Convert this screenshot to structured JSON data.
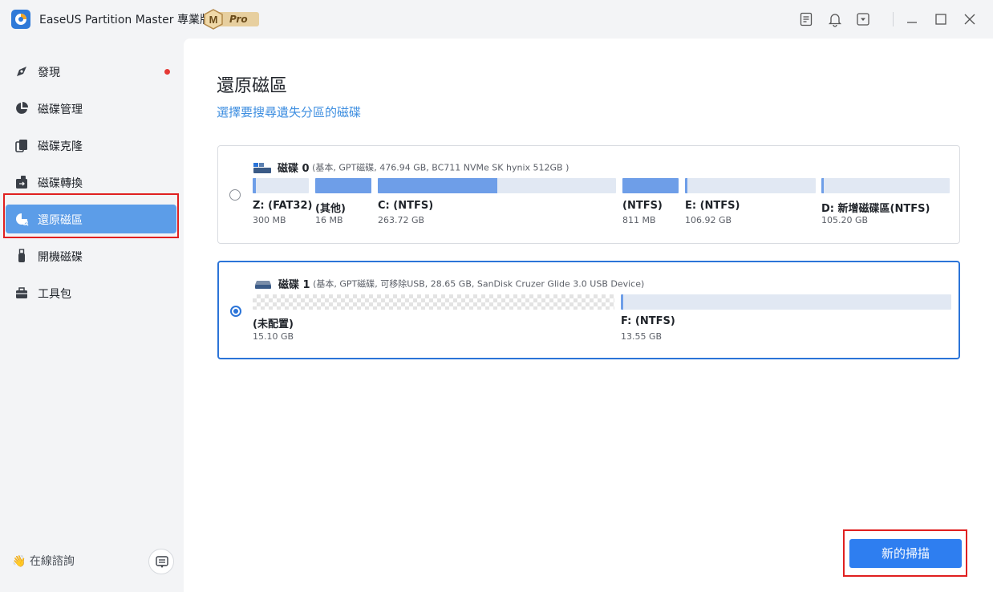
{
  "app": {
    "title": "EaseUS Partition Master 專業版",
    "badge_letter": "M",
    "badge_text": "Pro"
  },
  "titlebar_icons": [
    "notes-icon",
    "bell-icon",
    "dropdown-menu-icon",
    "minimize-icon",
    "maximize-icon",
    "close-icon"
  ],
  "sidebar": {
    "items": [
      {
        "label": "發現",
        "icon": "compass-icon",
        "has_dot": true
      },
      {
        "label": "磁碟管理",
        "icon": "pie-chart-icon"
      },
      {
        "label": "磁碟克隆",
        "icon": "clone-icon"
      },
      {
        "label": "磁碟轉換",
        "icon": "convert-icon"
      },
      {
        "label": "還原磁區",
        "icon": "recover-icon",
        "active": true
      },
      {
        "label": "開機磁碟",
        "icon": "usb-icon"
      },
      {
        "label": "工具包",
        "icon": "toolbox-icon"
      }
    ],
    "support_label": "👋 在線諮詢"
  },
  "main": {
    "title": "還原磁區",
    "subtitle": "選擇要搜尋遺失分區的磁碟",
    "disks": [
      {
        "name": "磁碟 0",
        "desc": " (基本, GPT磁碟, 476.94 GB, BC711 NVMe SK hynix 512GB )",
        "selected": false,
        "partitions": [
          {
            "label": "Z: (FAT32)",
            "size": "300 MB",
            "used_fraction": 0.05
          },
          {
            "label": "(其他)",
            "size": "16 MB",
            "used_fraction": 1.0
          },
          {
            "label": "C: (NTFS)",
            "size": "263.72 GB",
            "used_fraction": 0.5
          },
          {
            "label": "(NTFS)",
            "size": "811 MB",
            "used_fraction": 1.0
          },
          {
            "label": "E: (NTFS)",
            "size": "106.92 GB",
            "used_fraction": 0.01
          },
          {
            "label": "D: 新增磁碟區(NTFS)",
            "size": "105.20 GB",
            "used_fraction": 0.01
          }
        ]
      },
      {
        "name": "磁碟 1",
        "desc": " (基本, GPT磁碟, 可移除USB, 28.65 GB, SanDisk Cruzer Glide 3.0 USB Device)",
        "selected": true,
        "partitions": [
          {
            "label": "(未配置)",
            "size": "15.10 GB",
            "unallocated": true
          },
          {
            "label": "F: (NTFS)",
            "size": "13.55 GB",
            "used_fraction": 0.0
          }
        ]
      }
    ],
    "scan_button": "新的掃描"
  },
  "colors": {
    "accent": "#2e7ef0",
    "sidebar_active": "#5c9de8",
    "partition_fill": "#6e9ee8",
    "partition_bg": "#e1e8f3",
    "highlight_box": "#e02020"
  }
}
